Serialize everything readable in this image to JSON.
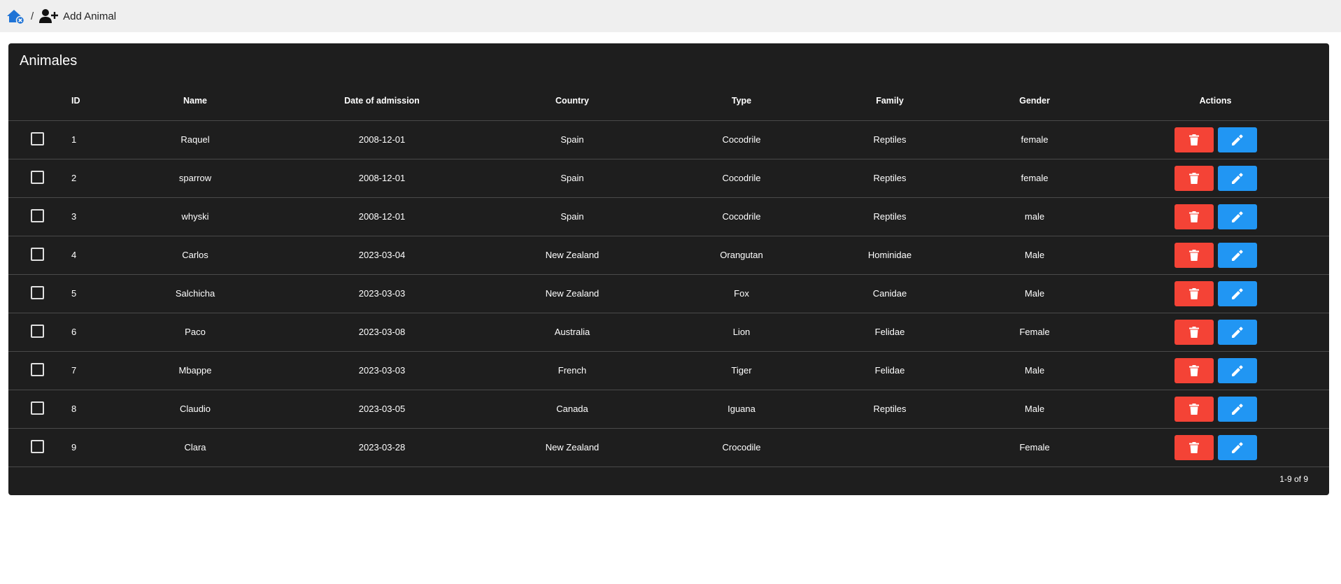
{
  "breadcrumb": {
    "separator": "/",
    "add_label": "Add Animal"
  },
  "card": {
    "title": "Animales"
  },
  "table": {
    "headers": {
      "id": "ID",
      "name": "Name",
      "date": "Date of admission",
      "country": "Country",
      "type": "Type",
      "family": "Family",
      "gender": "Gender",
      "actions": "Actions"
    },
    "rows": [
      {
        "id": "1",
        "name": "Raquel",
        "date": "2008-12-01",
        "country": "Spain",
        "type": "Cocodrile",
        "family": "Reptiles",
        "gender": "female"
      },
      {
        "id": "2",
        "name": "sparrow",
        "date": "2008-12-01",
        "country": "Spain",
        "type": "Cocodrile",
        "family": "Reptiles",
        "gender": "female"
      },
      {
        "id": "3",
        "name": "whyski",
        "date": "2008-12-01",
        "country": "Spain",
        "type": "Cocodrile",
        "family": "Reptiles",
        "gender": "male"
      },
      {
        "id": "4",
        "name": "Carlos",
        "date": "2023-03-04",
        "country": "New Zealand",
        "type": "Orangutan",
        "family": "Hominidae",
        "gender": "Male"
      },
      {
        "id": "5",
        "name": "Salchicha",
        "date": "2023-03-03",
        "country": "New Zealand",
        "type": "Fox",
        "family": "Canidae",
        "gender": "Male"
      },
      {
        "id": "6",
        "name": "Paco",
        "date": "2023-03-08",
        "country": "Australia",
        "type": "Lion",
        "family": "Felidae",
        "gender": "Female"
      },
      {
        "id": "7",
        "name": "Mbappe",
        "date": "2023-03-03",
        "country": "French",
        "type": "Tiger",
        "family": "Felidae",
        "gender": "Male"
      },
      {
        "id": "8",
        "name": "Claudio",
        "date": "2023-03-05",
        "country": "Canada",
        "type": "Iguana",
        "family": "Reptiles",
        "gender": "Male"
      },
      {
        "id": "9",
        "name": "Clara",
        "date": "2023-03-28",
        "country": "New Zealand",
        "type": "Crocodile",
        "family": "",
        "gender": "Female"
      }
    ]
  },
  "pagination": {
    "label": "1-9 of 9"
  },
  "icons": {
    "home": "home-icon",
    "add_user": "add-user-icon",
    "delete": "trash-icon",
    "edit": "pencil-icon"
  },
  "colors": {
    "delete": "#f44336",
    "edit": "#2196f3",
    "card_bg": "#1e1e1e",
    "topbar_bg": "#efefef",
    "home_icon": "#1e73d6"
  }
}
